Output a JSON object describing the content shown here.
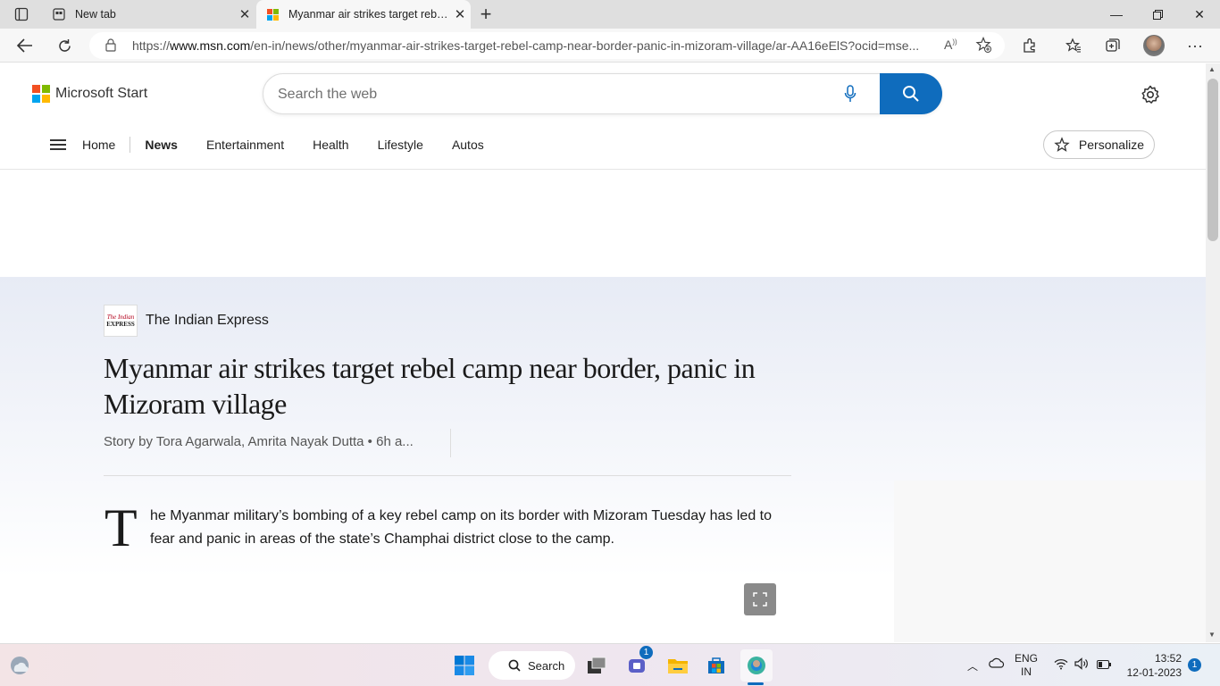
{
  "browser": {
    "tabs": [
      {
        "title": "New tab",
        "active": false
      },
      {
        "title": "Myanmar air strikes target rebel camp near border, panic in Mizoram village",
        "active": true
      }
    ],
    "url_prefix": "https://",
    "url_domain": "www.msn.com",
    "url_path": "/en-in/news/other/myanmar-air-strikes-target-rebel-camp-near-border-panic-in-mizoram-village/ar-AA16eElS?ocid=mse..."
  },
  "header": {
    "brand": "Microsoft Start",
    "search_placeholder": "Search the web",
    "nav": [
      {
        "label": "Home"
      },
      {
        "label": "News",
        "active": true
      },
      {
        "label": "Entertainment"
      },
      {
        "label": "Health"
      },
      {
        "label": "Lifestyle"
      },
      {
        "label": "Autos"
      }
    ],
    "personalize_label": "Personalize"
  },
  "article": {
    "publisher": "The Indian Express",
    "publisher_logo_line1": "The Indian",
    "publisher_logo_line2": "EXPRESS",
    "headline": "Myanmar air strikes target rebel camp near border, panic in Mizoram village",
    "byline": "Story by Tora Agarwala, Amrita Nayak Dutta • 6h a...",
    "dropcap": "T",
    "body": "he Myanmar military’s bombing of a key rebel camp on its border with Mizoram Tuesday has led to fear and panic in areas of the state’s Champhai district close to the camp."
  },
  "taskbar": {
    "search_label": "Search",
    "chat_badge": "1",
    "lang_top": "ENG",
    "lang_bottom": "IN",
    "time": "13:52",
    "date": "12-01-2023",
    "notif_count": "1"
  },
  "colors": {
    "accent": "#0f6cbd",
    "ms_red": "#f25022",
    "ms_green": "#7fba00",
    "ms_blue": "#00a4ef",
    "ms_yellow": "#ffb900"
  }
}
